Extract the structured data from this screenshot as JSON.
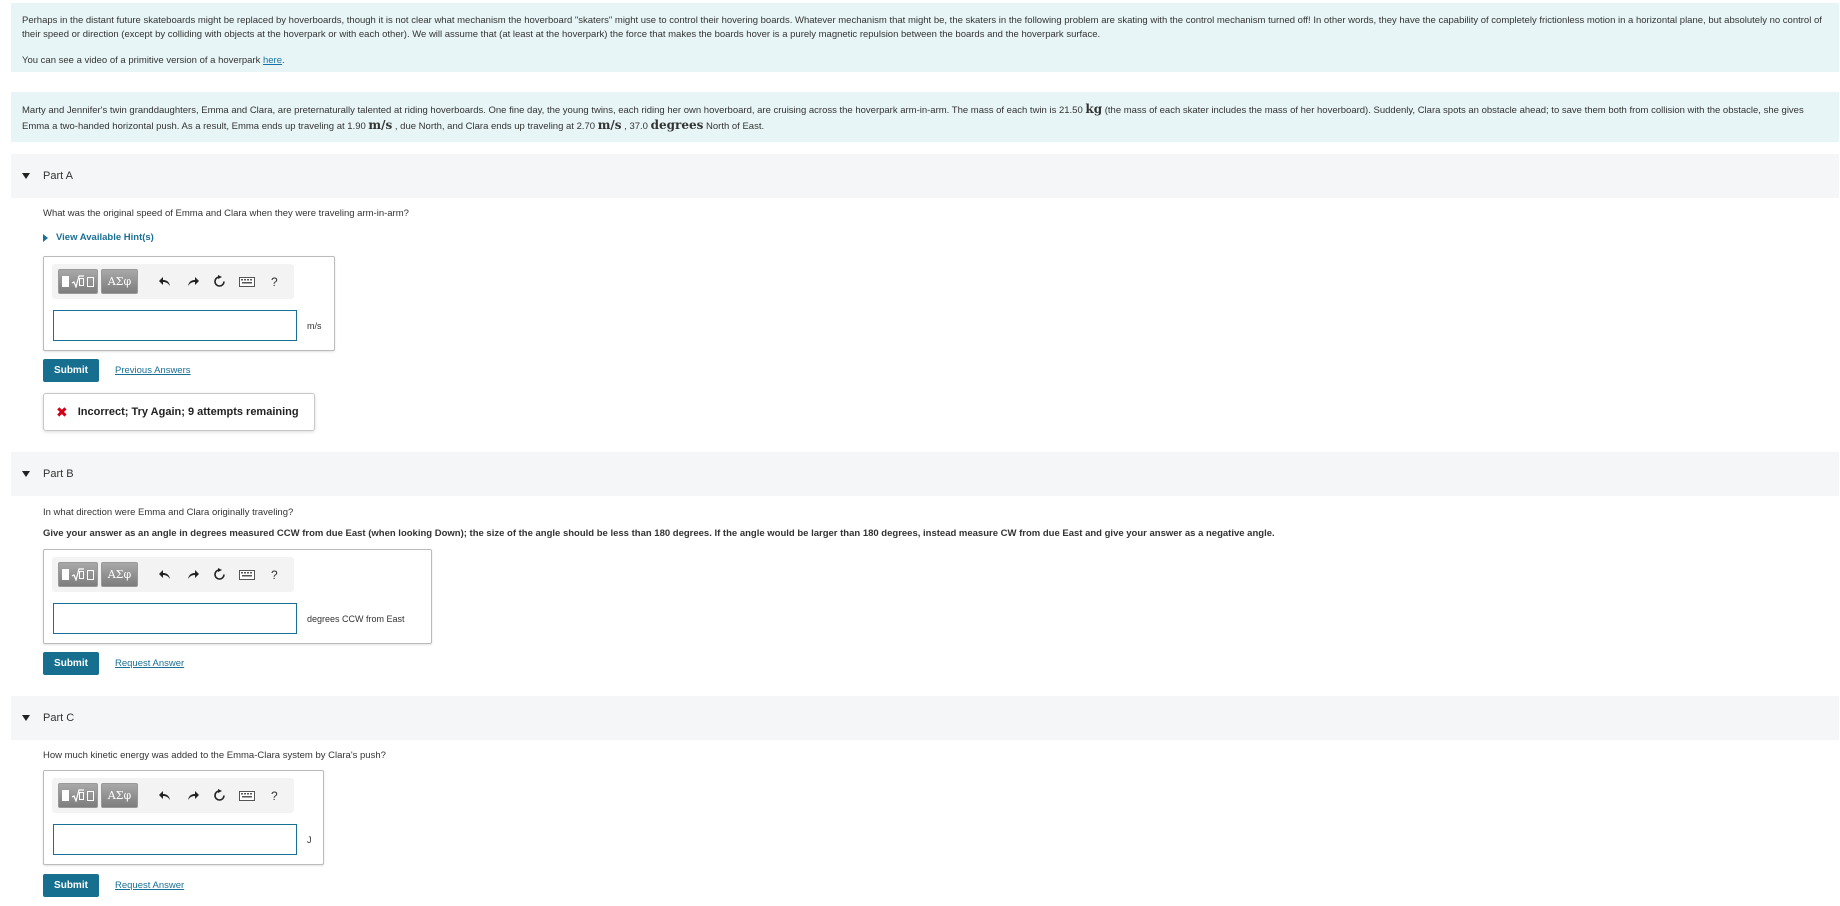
{
  "intro": {
    "paragraph1": "Perhaps in the distant future skateboards might be replaced by hoverboards, though it is not clear what mechanism the hoverboard \"skaters\" might use to control their hovering boards. Whatever mechanism that might be, the skaters in the following problem are skating with the control mechanism turned off! In other words, they have the capability of completely frictionless motion in a horizontal plane, but absolutely no control of their speed or direction (except by colliding with objects at the hoverpark or with each other). We will assume that (at least at the hoverpark) the force that makes the boards hover is a purely magnetic repulsion between the boards and the hoverpark surface.",
    "video_prefix": "You can see a video of a primitive version of a hoverpark ",
    "video_link": "here",
    "video_suffix": "."
  },
  "scenario": {
    "t1": "Marty and Jennifer's twin granddaughters, Emma and Clara, are preternaturally talented at riding hoverboards.  One fine day, the young twins, each riding her own hoverboard, are cruising across the hoverpark arm-in-arm.  The mass of each twin is 21.50 ",
    "u_kg": "kg",
    "t2": " (the mass of each skater includes the mass of her hoverboard).  Suddenly, Clara spots an obstacle ahead; to save them both from collision with the obstacle, she gives Emma a two-handed horizontal push. As a result, Emma ends up traveling at 1.90 ",
    "u_ms1": "m/s",
    "t3": " , due North, and Clara ends up traveling at 2.70 ",
    "u_ms2": "m/s",
    "t4": " , 37.0 ",
    "u_deg": "degrees",
    "t5": " North of East."
  },
  "toolbar": {
    "greek_label": "ΑΣφ",
    "help_label": "?"
  },
  "partA": {
    "title": "Part A",
    "question": "What was the original speed of Emma and Clara when they were traveling arm-in-arm?",
    "hint": "View Available Hint(s)",
    "input_value": "",
    "unit": "m/s",
    "submit": "Submit",
    "link": "Previous Answers",
    "feedback": "Incorrect; Try Again; 9 attempts remaining"
  },
  "partB": {
    "title": "Part B",
    "question": "In what direction were Emma and Clara originally traveling?",
    "instruction": "Give your answer as an angle in degrees measured CCW from due East (when looking Down); the size of the angle should be less than 180 degrees.  If the angle would be larger than 180 degrees, instead measure CW from due East and give your answer as a negative angle.",
    "input_value": "",
    "unit": "degrees CCW from East",
    "submit": "Submit",
    "link": "Request Answer"
  },
  "partC": {
    "title": "Part C",
    "question": "How much kinetic energy was added to the Emma-Clara system by Clara's push?",
    "input_value": "",
    "unit": "J",
    "submit": "Submit",
    "link": "Request Answer"
  },
  "colors": {
    "intro_bg": "#e8f5f6",
    "part_header_bg": "#f5f6f7",
    "accent": "#166f8f",
    "error": "#d0021b"
  }
}
